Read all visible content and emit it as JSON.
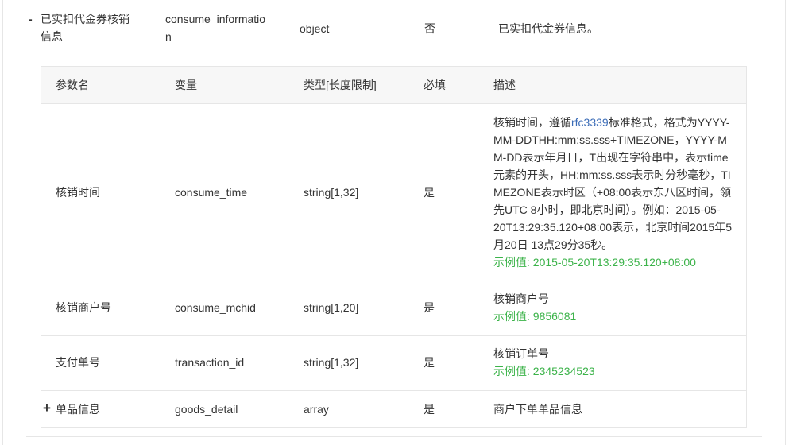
{
  "parent": {
    "name": "已实扣代金券核销信息",
    "name_line1": "已实扣代金券核销",
    "name_line2": "信息",
    "variable_line1": "consume_informatio",
    "variable_line2": "n",
    "type": "object",
    "required": "否",
    "description": "已实扣代金券信息。",
    "toggle": "-"
  },
  "nested": {
    "headers": {
      "param": "参数名",
      "variable": "变量",
      "type": "类型[长度限制]",
      "required": "必填",
      "description": "描述"
    },
    "rows": [
      {
        "name": "核销时间",
        "variable": "consume_time",
        "type": "string[1,32]",
        "required": "是",
        "desc_pre": "核销时间，遵循",
        "desc_link": "rfc3339",
        "desc_l1_post": "标准格式，格式为YYYY-",
        "desc_l2": "MM-DDTHH:mm:ss.sss+TIMEZONE，YYYY-M",
        "desc_l3": "M-DD表示年月日，T出现在字符串中，表示time",
        "desc_l4": "元素的开头，HH:mm:ss.sss表示时分秒毫秒，TI",
        "desc_l5": "MEZONE表示时区（+08:00表示东八区时间，领",
        "desc_l6": "先UTC 8小时，即北京时间）。例如：2015-05-",
        "desc_l7": "20T13:29:35.120+08:00表示，北京时间2015年5",
        "desc_l8": "月20日 13点29分35秒。",
        "example": "示例值: 2015-05-20T13:29:35.120+08:00"
      },
      {
        "name": "核销商户号",
        "variable": "consume_mchid",
        "type": "string[1,20]",
        "required": "是",
        "desc": "核销商户号",
        "example": "示例值: 9856081"
      },
      {
        "name": "支付单号",
        "variable": "transaction_id",
        "type": "string[1,32]",
        "required": "是",
        "desc": "核销订单号",
        "example": "示例值: 2345234523"
      },
      {
        "name": "单品信息",
        "variable": "goods_detail",
        "type": "array",
        "required": "是",
        "desc": "商户下单单品信息",
        "toggle": "+"
      }
    ]
  }
}
